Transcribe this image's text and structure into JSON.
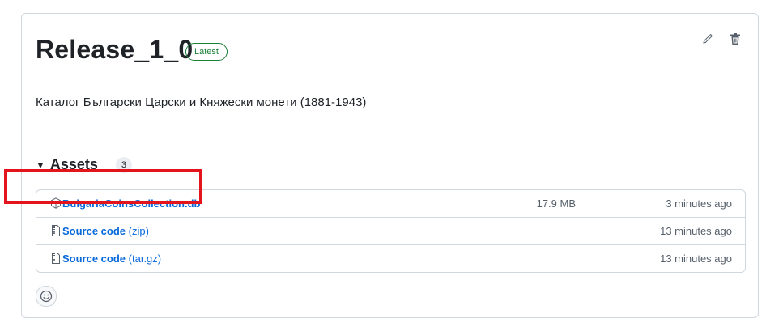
{
  "release": {
    "title": "Release_1_0",
    "badge": "Latest",
    "description": "Каталог Български Царски и Княжески монети (1881-1943)"
  },
  "actions": {
    "edit_icon": "pencil-icon",
    "delete_icon": "trash-icon"
  },
  "assets": {
    "title": "Assets",
    "count": "3",
    "items": [
      {
        "icon": "package-icon",
        "name": "BulgariaCoinsCollection.db",
        "ext": "",
        "size": "17.9 MB",
        "time": "3 minutes ago"
      },
      {
        "icon": "file-zip-icon",
        "name": "Source code",
        "ext": "(zip)",
        "size": "",
        "time": "13 minutes ago"
      },
      {
        "icon": "file-zip-icon",
        "name": "Source code",
        "ext": "(tar.gz)",
        "size": "",
        "time": "13 minutes ago"
      }
    ]
  },
  "reaction_icon": "smiley-icon",
  "colors": {
    "link": "#0969da",
    "badge_green": "#1a7f37",
    "highlight_red": "#e3141c",
    "border": "#d0d7de",
    "muted_text": "#57606a"
  }
}
